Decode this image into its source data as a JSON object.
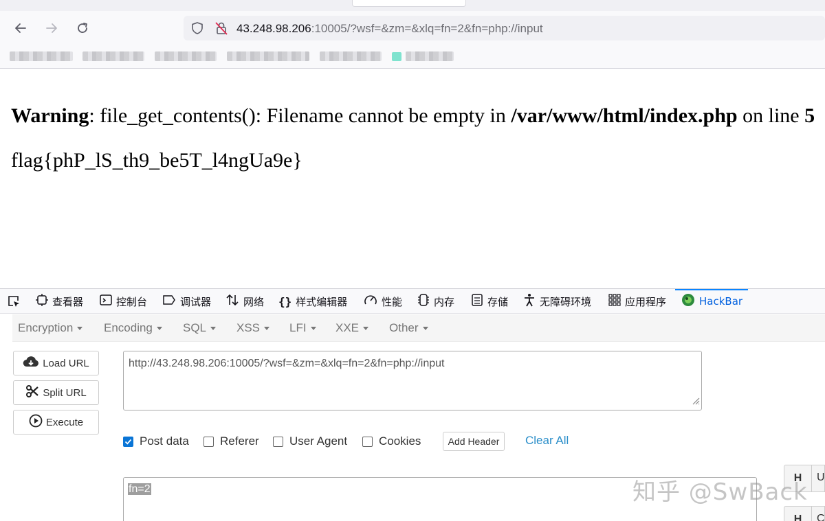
{
  "browser": {
    "url_host": "43.248.98.206",
    "url_rest": ":10005/?wsf=&zm=&xlq=fn=2&fn=php://input",
    "nav_icons": [
      "back-arrow-icon",
      "forward-arrow-icon",
      "reload-icon",
      "shield-icon",
      "insecure-lock-icon"
    ]
  },
  "page": {
    "warning_label": "Warning",
    "warning_msg": ": file_get_contents(): Filename cannot be empty in ",
    "warning_path": "/var/www/html/index.php",
    "warning_online": " on line ",
    "warning_line": "5",
    "flag": "flag{phP_lS_th9_be5T_l4ngUa9e}"
  },
  "devtools": {
    "tabs": [
      {
        "label": "查看器",
        "icon": "inspector-icon"
      },
      {
        "label": "控制台",
        "icon": "console-icon"
      },
      {
        "label": "调试器",
        "icon": "debugger-icon"
      },
      {
        "label": "网络",
        "icon": "network-icon"
      },
      {
        "label": "样式编辑器",
        "icon": "style-editor-icon"
      },
      {
        "label": "性能",
        "icon": "performance-icon"
      },
      {
        "label": "内存",
        "icon": "memory-icon"
      },
      {
        "label": "存储",
        "icon": "storage-icon"
      },
      {
        "label": "无障碍环境",
        "icon": "accessibility-icon"
      },
      {
        "label": "应用程序",
        "icon": "application-icon"
      },
      {
        "label": "HackBar",
        "icon": "hackbar-icon"
      }
    ],
    "accent": "#0a84ff"
  },
  "hackbar": {
    "menus": [
      "Encryption",
      "Encoding",
      "SQL",
      "XSS",
      "LFI",
      "XXE",
      "Other"
    ],
    "buttons": {
      "load": "Load URL",
      "split": "Split URL",
      "execute": "Execute"
    },
    "url_value": "http://43.248.98.206:10005/?wsf=&zm=&xlq=fn=2&fn=php://input",
    "options": {
      "post_data": {
        "label": "Post data",
        "checked": true
      },
      "referer": {
        "label": "Referer",
        "checked": false
      },
      "user_agent": {
        "label": "User Agent",
        "checked": false
      },
      "cookies": {
        "label": "Cookies",
        "checked": false
      }
    },
    "add_header": "Add Header",
    "clear_all": "Clear All",
    "post_value": "fn=2",
    "header_rows": [
      {
        "h": "H",
        "v": "U"
      },
      {
        "h": "H",
        "v": "C"
      }
    ]
  },
  "watermark": "知乎 @SwBack"
}
